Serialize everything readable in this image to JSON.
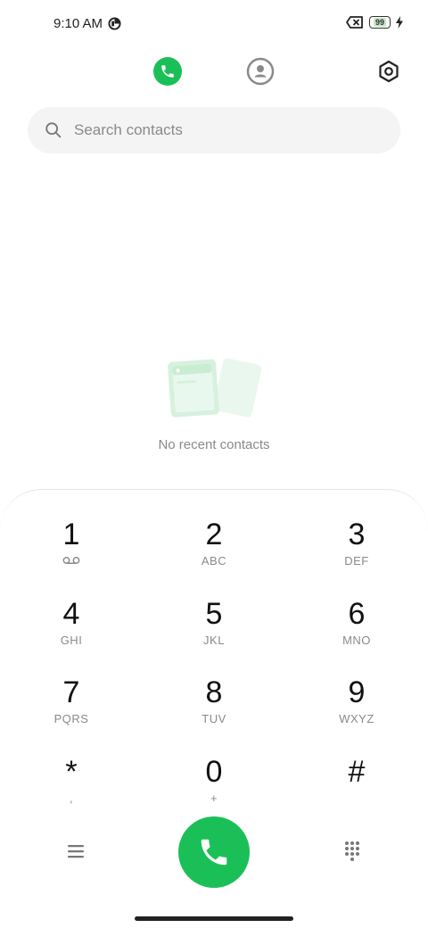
{
  "status_bar": {
    "time": "9:10 AM",
    "battery_level": "99",
    "icons": [
      "data-saver-icon",
      "no-sim-icon",
      "battery-icon",
      "charging-bolt-icon"
    ]
  },
  "top_tabs": {
    "active": "phone",
    "icons": [
      "phone-icon",
      "contacts-icon",
      "settings-icon"
    ]
  },
  "search": {
    "placeholder": "Search contacts",
    "value": ""
  },
  "empty_state": {
    "message": "No recent contacts"
  },
  "dialpad": {
    "keys": [
      {
        "digit": "1",
        "letters": ""
      },
      {
        "digit": "2",
        "letters": "ABC"
      },
      {
        "digit": "3",
        "letters": "DEF"
      },
      {
        "digit": "4",
        "letters": "GHI"
      },
      {
        "digit": "5",
        "letters": "JKL"
      },
      {
        "digit": "6",
        "letters": "MNO"
      },
      {
        "digit": "7",
        "letters": "PQRS"
      },
      {
        "digit": "8",
        "letters": "TUV"
      },
      {
        "digit": "9",
        "letters": "WXYZ"
      },
      {
        "digit": "*",
        "letters": ","
      },
      {
        "digit": "0",
        "letters": "+"
      },
      {
        "digit": "#",
        "letters": ""
      }
    ]
  },
  "colors": {
    "accent": "#1bbf58",
    "text_muted": "#8a8a8a",
    "search_bg": "#f4f4f4"
  }
}
